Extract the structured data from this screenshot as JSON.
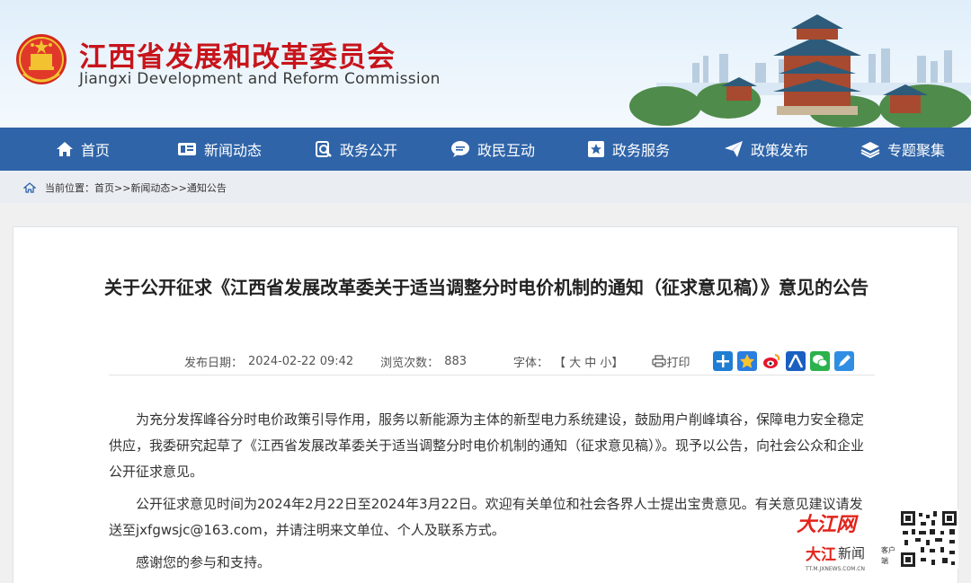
{
  "header": {
    "site_name_cn": "江西省发展和改革委员会",
    "site_name_en": "Jiangxi Development and Reform Commission"
  },
  "nav": {
    "items": [
      {
        "label": "首页",
        "icon": "home-icon"
      },
      {
        "label": "新闻动态",
        "icon": "news-icon"
      },
      {
        "label": "政务公开",
        "icon": "search-doc-icon"
      },
      {
        "label": "政民互动",
        "icon": "chat-icon"
      },
      {
        "label": "政务服务",
        "icon": "star-badge-icon"
      },
      {
        "label": "政策发布",
        "icon": "paper-plane-icon"
      },
      {
        "label": "专题聚集",
        "icon": "layers-icon"
      }
    ]
  },
  "breadcrumb": {
    "prefix": "当前位置：",
    "items": [
      "首页",
      "新闻动态",
      "通知公告"
    ],
    "sep": ">>"
  },
  "article": {
    "title": "关于公开征求《江西省发展改革委关于适当调整分时电价机制的通知（征求意见稿）》意见的公告",
    "publish_label": "发布日期：",
    "publish_date": "2024-02-22 09:42",
    "views_label": "浏览次数：",
    "views": "883",
    "font_label": "字体：",
    "font_sizes": "【 大 中 小】",
    "print_label": "打印",
    "paragraphs": [
      "为充分发挥峰谷分时电价政策引导作用，服务以新能源为主体的新型电力系统建设，鼓励用户削峰填谷，保障电力安全稳定供应，我委研究起草了《江西省发展改革委关于适当调整分时电价机制的通知（征求意见稿）》。现予以公告，向社会公众和企业公开征求意见。",
      "公开征求意见时间为2024年2月22日至2024年3月22日。欢迎有关单位和社会各界人士提出宝贵意见。有关意见建议请发送至jxfgwsjc@163.com，并请注明来文单位、个人及联系方式。",
      "感谢您的参与和支持。"
    ]
  },
  "watermark": {
    "brand": "大江网",
    "app": "大江新闻",
    "client": "客户端",
    "url": "TT.M.JXNEWS.COM.CN"
  },
  "colors": {
    "nav_bg": "#2f64a8",
    "title_red": "#c8141b",
    "crumb_bg": "#eaeef3"
  }
}
